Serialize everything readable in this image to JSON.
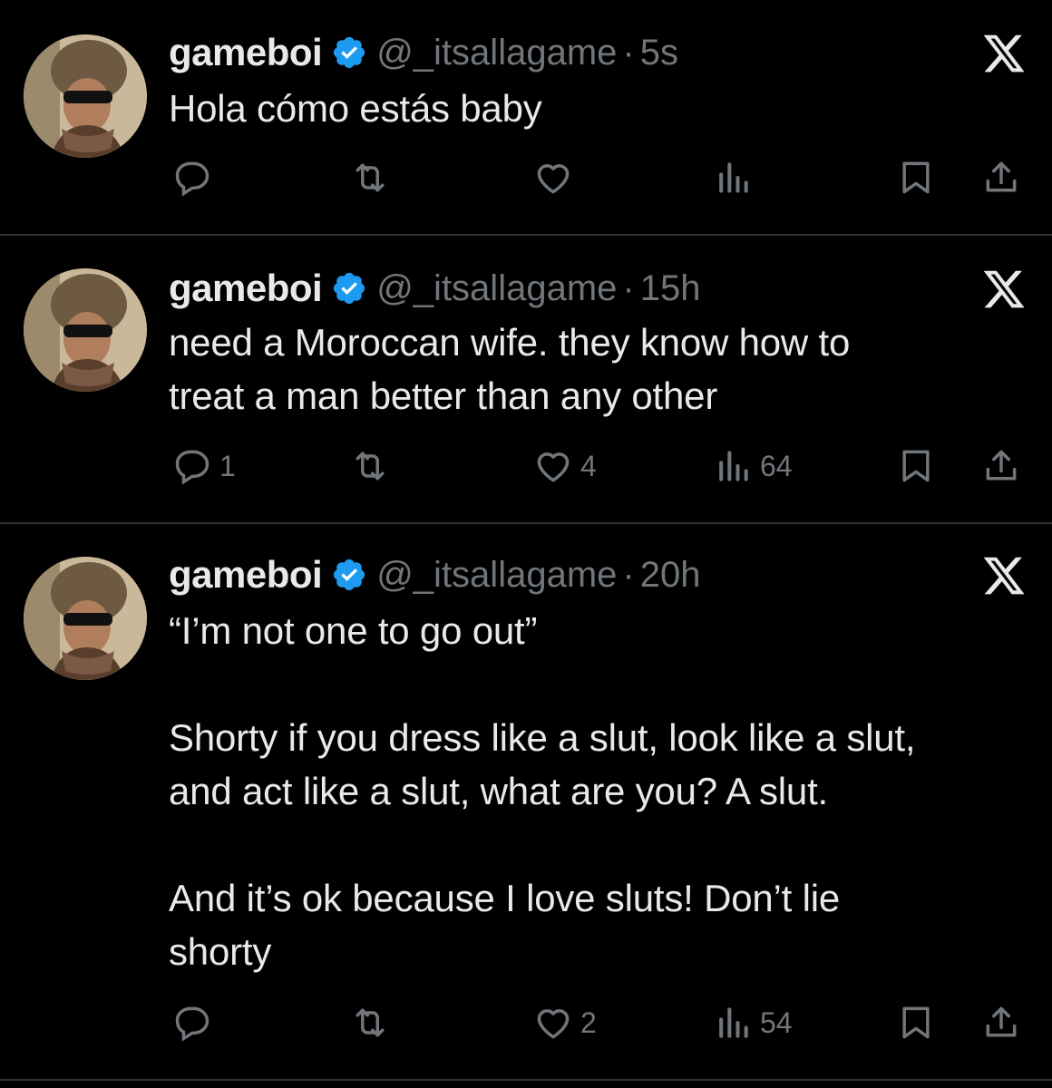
{
  "tweets": [
    {
      "name": "gameboi",
      "handle": "@_itsallagame",
      "separator": "·",
      "time": "5s",
      "text": "Hola cómo estás baby",
      "replies": "",
      "retweets": "",
      "likes": "",
      "views": ""
    },
    {
      "name": "gameboi",
      "handle": "@_itsallagame",
      "separator": "·",
      "time": "15h",
      "text": "need a Moroccan wife. they know how to\ntreat a man better than any other",
      "replies": "1",
      "retweets": "",
      "likes": "4",
      "views": "64"
    },
    {
      "name": "gameboi",
      "handle": "@_itsallagame",
      "separator": "·",
      "time": "20h",
      "text": "“I’m not one to go out”\n\nShorty if you dress like a slut, look like a slut,\nand act like a slut, what are you? A slut.\n\nAnd it’s ok because I love sluts! Don’t lie\nshorty",
      "replies": "",
      "retweets": "",
      "likes": "2",
      "views": "54"
    }
  ],
  "icons": {
    "verified": "verified-badge-icon",
    "x_logo": "x-logo-icon",
    "reply": "reply-icon",
    "retweet": "retweet-icon",
    "like": "heart-icon",
    "views": "views-icon",
    "bookmark": "bookmark-icon",
    "share": "share-icon"
  },
  "colors": {
    "background": "#000000",
    "text": "#e7e9ea",
    "muted": "#71767b",
    "verified": "#1d9bf0",
    "divider": "#2f3336"
  }
}
